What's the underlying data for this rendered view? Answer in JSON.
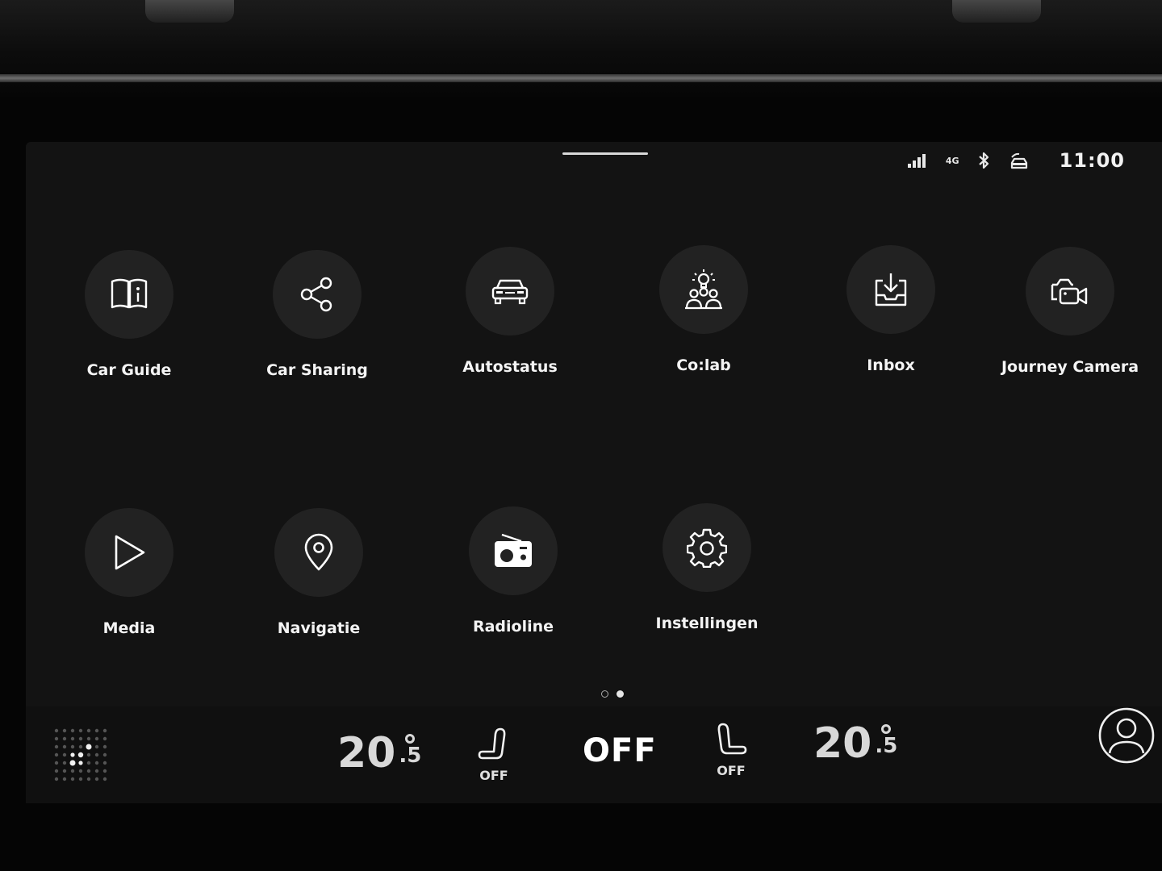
{
  "status_bar": {
    "network": "4G",
    "time": "11:00",
    "icons": [
      "signal-icon",
      "network-4g-icon",
      "bluetooth-icon",
      "car-connected-icon"
    ]
  },
  "apps": [
    {
      "label": "Car Guide",
      "icon": "book-info-icon"
    },
    {
      "label": "Car Sharing",
      "icon": "share-icon"
    },
    {
      "label": "Autostatus",
      "icon": "car-front-icon"
    },
    {
      "label": "Co:lab",
      "icon": "community-idea-icon"
    },
    {
      "label": "Inbox",
      "icon": "inbox-download-icon"
    },
    {
      "label": "Journey Camera",
      "icon": "camera-icon"
    },
    {
      "label": "Media",
      "icon": "play-icon"
    },
    {
      "label": "Navigatie",
      "icon": "location-pin-icon"
    },
    {
      "label": "Radioline",
      "icon": "radio-icon"
    },
    {
      "label": "Instellingen",
      "icon": "gear-icon"
    }
  ],
  "pagination": {
    "pages": 2,
    "current": 2
  },
  "climate": {
    "left_temp_main": "20",
    "left_temp_decimal": ".5",
    "left_seat_heat": "OFF",
    "fan": "OFF",
    "right_seat_heat": "OFF",
    "right_temp_main": "20",
    "right_temp_decimal": ".5"
  },
  "colors": {
    "screen_bg": "#131313",
    "tile_bg": "#222222",
    "text": "#f4f4f4"
  }
}
